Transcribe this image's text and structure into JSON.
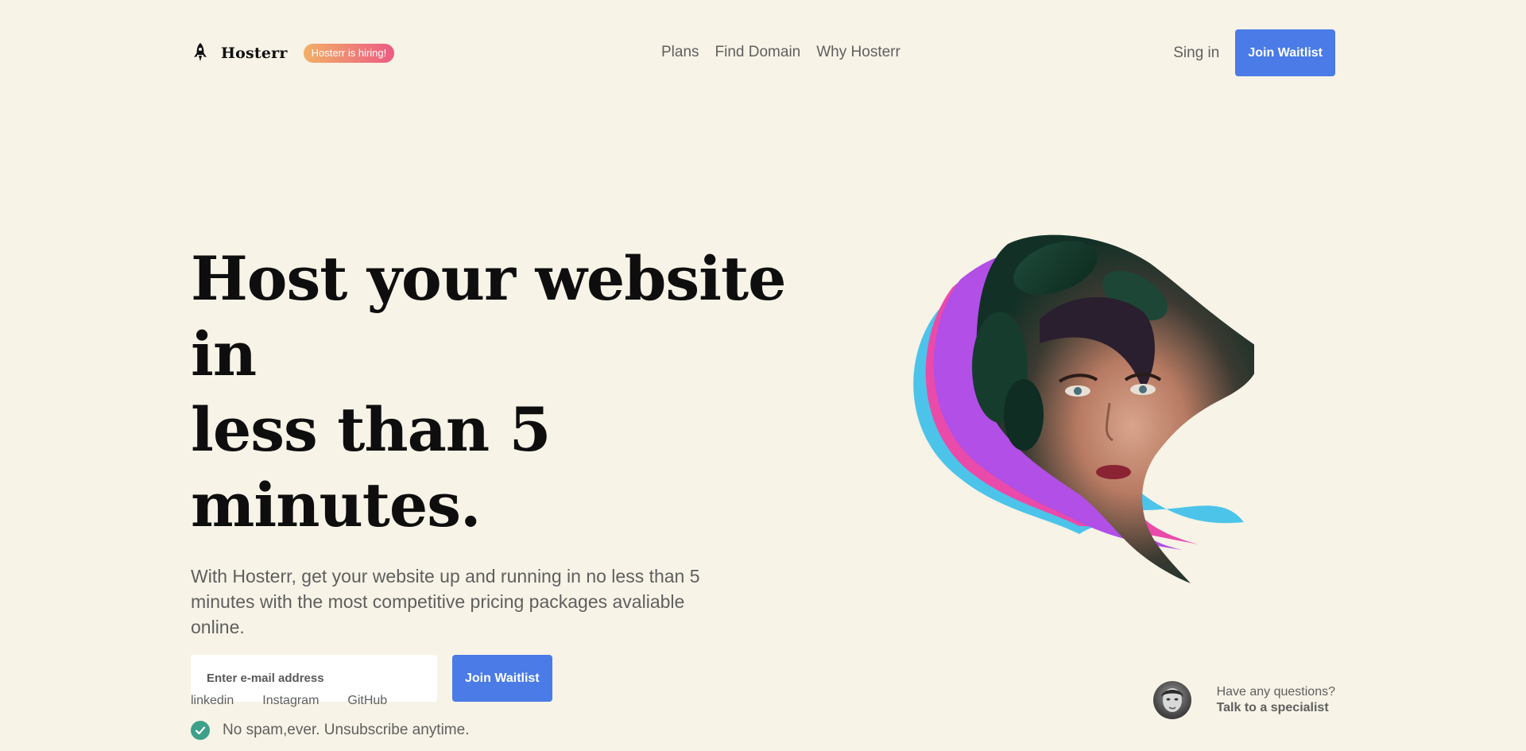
{
  "brand": {
    "name": "Hosterr",
    "badge": "Hosterr is hiring!"
  },
  "nav": {
    "items": [
      {
        "label": "Plans"
      },
      {
        "label": "Find Domain"
      },
      {
        "label": "Why Hosterr"
      }
    ]
  },
  "header": {
    "signin_label": "Sing in",
    "join_label": "Join Waitlist"
  },
  "hero": {
    "headline_line1": "Host your website in",
    "headline_line2": "less than 5 minutes.",
    "subtext": "With Hosterr, get your website up and running in no less than 5 minutes with the most competitive pricing packages avaliable online.",
    "email_placeholder": "Enter e-mail address",
    "cta_label": "Join Waitlist",
    "note": "No spam,ever. Unsubscribe anytime."
  },
  "footer": {
    "social": [
      {
        "label": "linkedin"
      },
      {
        "label": "Instagram"
      },
      {
        "label": "GitHub"
      }
    ],
    "question": "Have any questions?",
    "cta": "Talk to a specialist"
  },
  "colors": {
    "background": "#f7f3e7",
    "primary": "#4a7be6",
    "check": "#3da08a",
    "art_purple": "#b14fe6",
    "art_pink": "#ea4aa9",
    "art_cyan": "#4cc4ea"
  },
  "icons": {
    "brand": "rocket-icon",
    "check": "check-circle-icon"
  }
}
